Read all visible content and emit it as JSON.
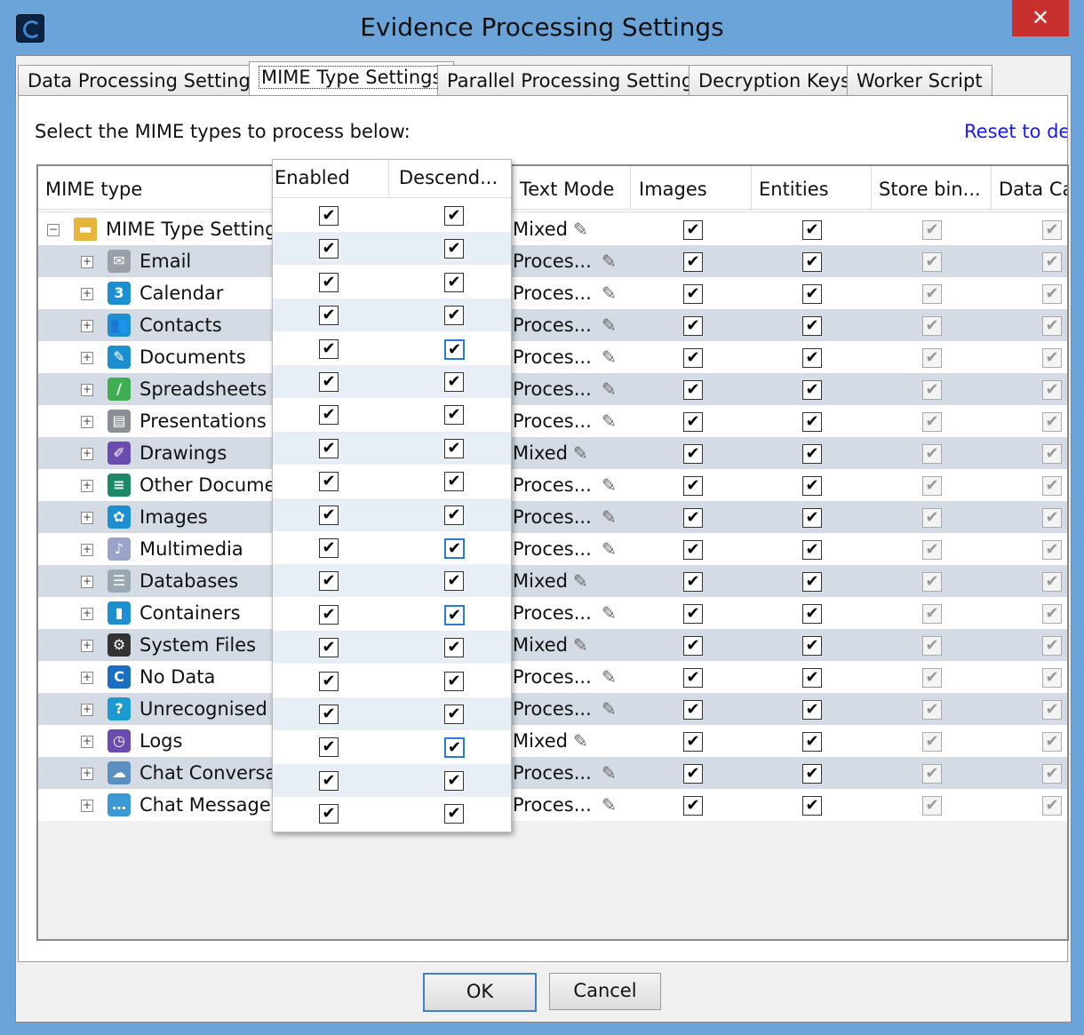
{
  "window": {
    "title": "Evidence Processing Settings",
    "close_glyph": "✕"
  },
  "tabs": [
    {
      "label": "Data Processing Settings"
    },
    {
      "label": "MIME Type Settings"
    },
    {
      "label": "Parallel Processing Settings"
    },
    {
      "label": "Decryption Keys"
    },
    {
      "label": "Worker Script"
    }
  ],
  "panel": {
    "prompt": "Select the MIME types to process below:",
    "reset_link": "Reset to de"
  },
  "table": {
    "headers": {
      "mime_type": "MIME type",
      "text_mode": "Text Mode",
      "images": "Images",
      "entities": "Entities",
      "store_binary": "Store bin...",
      "data_carving": "Data Ca"
    },
    "popup_headers": {
      "enabled": "Enabled",
      "descendants": "Descend..."
    },
    "root": {
      "label": "MIME Type Settings",
      "text_mode": "Mixed"
    },
    "rows": [
      {
        "label": "Email",
        "text_mode": "Proces...",
        "icon": "email-icon",
        "color": "#9aa0a8",
        "glyph": "✉"
      },
      {
        "label": "Calendar",
        "text_mode": "Proces...",
        "icon": "calendar-icon",
        "color": "#1b8fd2",
        "glyph": "3"
      },
      {
        "label": "Contacts",
        "text_mode": "Proces...",
        "icon": "contacts-icon",
        "color": "#1b8fd2",
        "glyph": "👥"
      },
      {
        "label": "Documents",
        "text_mode": "Proces...",
        "icon": "documents-icon",
        "color": "#1b8fd2",
        "glyph": "✎"
      },
      {
        "label": "Spreadsheets",
        "text_mode": "Proces...",
        "icon": "spreadsheets-icon",
        "color": "#3fae52",
        "glyph": "/"
      },
      {
        "label": "Presentations",
        "text_mode": "Proces...",
        "icon": "presentations-icon",
        "color": "#8a8f96",
        "glyph": "▤"
      },
      {
        "label": "Drawings",
        "text_mode": "Mixed",
        "icon": "drawings-icon",
        "color": "#6a4bb0",
        "glyph": "✐"
      },
      {
        "label": "Other Documer",
        "text_mode": "Proces...",
        "icon": "other-documents-icon",
        "color": "#1a8a6a",
        "glyph": "≡"
      },
      {
        "label": "Images",
        "text_mode": "Proces...",
        "icon": "images-icon",
        "color": "#1b8fd2",
        "glyph": "✿"
      },
      {
        "label": "Multimedia",
        "text_mode": "Proces...",
        "icon": "multimedia-icon",
        "color": "#9aa4c8",
        "glyph": "♪"
      },
      {
        "label": "Databases",
        "text_mode": "Mixed",
        "icon": "databases-icon",
        "color": "#9aa8b4",
        "glyph": "☰"
      },
      {
        "label": "Containers",
        "text_mode": "Proces...",
        "icon": "containers-icon",
        "color": "#1b8fd2",
        "glyph": "▮"
      },
      {
        "label": "System Files",
        "text_mode": "Mixed",
        "icon": "system-files-icon",
        "color": "#333333",
        "glyph": "⚙"
      },
      {
        "label": "No Data",
        "text_mode": "Proces...",
        "icon": "no-data-icon",
        "color": "#1b6fc2",
        "glyph": "C"
      },
      {
        "label": "Unrecognised",
        "text_mode": "Proces...",
        "icon": "unrecognised-icon",
        "color": "#1b9ad2",
        "glyph": "?"
      },
      {
        "label": "Logs",
        "text_mode": "Mixed",
        "icon": "logs-icon",
        "color": "#6a4bb0",
        "glyph": "◷"
      },
      {
        "label": "Chat Conversat",
        "text_mode": "Proces...",
        "icon": "chat-conversations-icon",
        "color": "#5b8fc2",
        "glyph": "☁"
      },
      {
        "label": "Chat Messages",
        "text_mode": "Proces...",
        "icon": "chat-messages-icon",
        "color": "#3a9ad6",
        "glyph": "…"
      }
    ],
    "descendant_focus_rows": [
      4,
      10,
      12,
      16
    ]
  },
  "buttons": {
    "ok": "OK",
    "cancel": "Cancel"
  },
  "glyphs": {
    "check": "✔",
    "pencil": "✎",
    "expand": "+",
    "collapse": "−"
  }
}
